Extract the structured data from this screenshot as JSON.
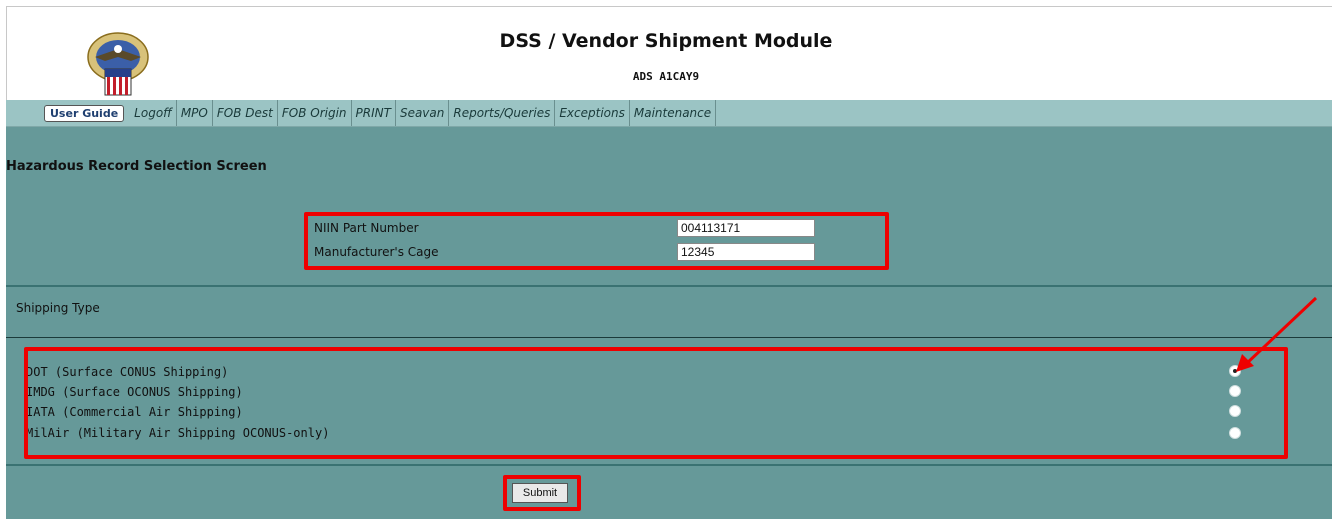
{
  "header": {
    "title": "DSS / Vendor Shipment Module",
    "subtitle": "ADS A1CAY9"
  },
  "nav": {
    "user_guide": "User Guide",
    "items": [
      "Logoff",
      "MPO",
      "FOB Dest",
      "FOB Origin",
      "PRINT",
      "Seavan",
      "Reports/Queries",
      "Exceptions",
      "Maintenance"
    ]
  },
  "screen": {
    "title": "Hazardous Record Selection Screen"
  },
  "form": {
    "niin_label": "NIIN Part Number",
    "niin_value": "004113171",
    "cage_label": "Manufacturer's Cage",
    "cage_value": "12345"
  },
  "shipping": {
    "label": "Shipping Type",
    "options": [
      {
        "label": "DOT (Surface CONUS Shipping)",
        "selected": true
      },
      {
        "label": "IMDG (Surface OCONUS Shipping)",
        "selected": false
      },
      {
        "label": "IATA (Commercial Air Shipping)",
        "selected": false
      },
      {
        "label": "MilAir (Military Air Shipping OCONUS-only)",
        "selected": false
      }
    ]
  },
  "actions": {
    "submit": "Submit"
  },
  "colors": {
    "content_bg": "#669999",
    "nav_bg": "#9bc4c4",
    "highlight": "#ee0000"
  }
}
